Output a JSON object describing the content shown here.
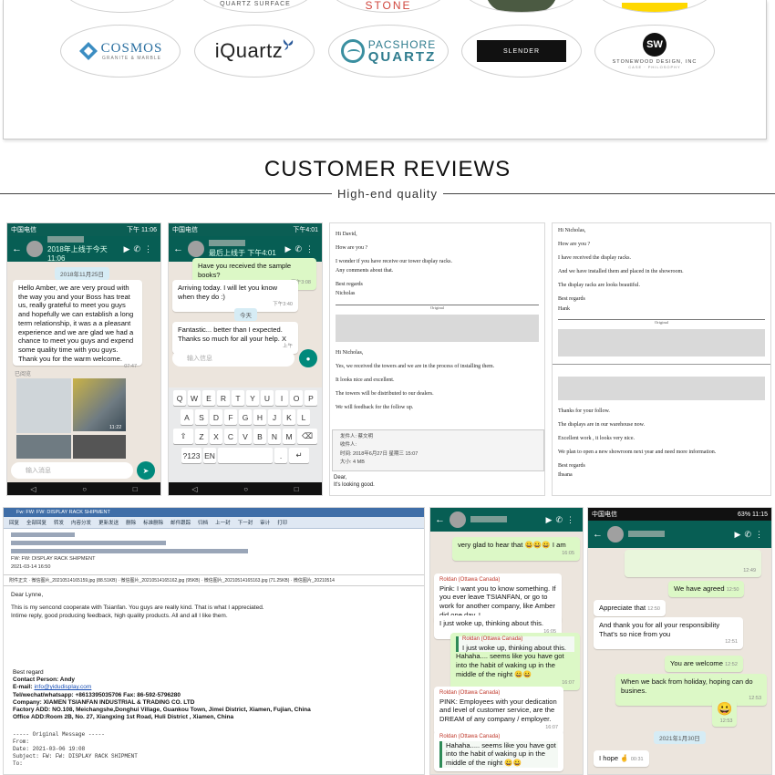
{
  "brands": {
    "top_partial": [
      "QUARTZ SURFACE",
      "STONE"
    ],
    "row": [
      {
        "name": "COSMOS",
        "tagline": "GRANITE & MARBLE"
      },
      {
        "name": "iQuartz"
      },
      {
        "name_top": "PACSHORE",
        "name_bottom": "QUARTZ"
      },
      {
        "name": "SLENDER"
      },
      {
        "name": "STONEWOOD DESIGN, INC",
        "initials": "SW",
        "tagline": "CASE · PHILOSOPHY"
      }
    ]
  },
  "section": {
    "title": "CUSTOMER REVIEWS",
    "subtitle": "High-end quality"
  },
  "shot1": {
    "status": "中国电信",
    "time": "下午 11:06",
    "header_time": "2018年上线于今天 11:06",
    "date_chip": "2018年11月25日",
    "message": "Hello Amber, we are very proud with the way you and your Boss has treat us, really grateful to meet you guys and hopefully we can establish a long term relationship, it was a a pleasant experience and we are glad we had a chance to meet you guys and expend some quality time with you guys. Thank you for the warm welcome.",
    "msg_time": "07:47",
    "read_label": "已阅览",
    "img_time_1": "11:22",
    "img_time_2": "11:22",
    "input_placeholder": "输入消息"
  },
  "shot2": {
    "status": "中国电信",
    "time": "下午4:01",
    "header_time": "最后上线于 下午4:01",
    "out_msg": "Have you received the sample books?",
    "out_time": "下午3:08",
    "in_msg1": "Arriving today. I will let you know when they do :)",
    "in_time1": "下午3:40",
    "today_chip": "今天",
    "in_msg2": "Fantastic... better than I expected. Thanks so much for all your help. X",
    "in_time2": "上午",
    "input_placeholder": "输入信息",
    "keys_row1": [
      "Q",
      "W",
      "E",
      "R",
      "T",
      "Y",
      "U",
      "I",
      "O",
      "P"
    ],
    "keys_row2": [
      "A",
      "S",
      "D",
      "F",
      "G",
      "H",
      "J",
      "K",
      "L"
    ],
    "keys_row3": [
      "Z",
      "X",
      "C",
      "V",
      "B",
      "N",
      "M"
    ],
    "key_num": "?123",
    "key_lang": "EN"
  },
  "shot3": {
    "greeting": "Hi David,",
    "l1": "How are you ?",
    "l2": "I wonder if you have receive our tower display racks.",
    "l3": "Any comments about that.",
    "l4": "Best regards",
    "l5": "Nicholas",
    "orig": "Original",
    "reply_greet": "Hi Nicholas,",
    "r1": "Yes, we received the towers and we are in the process of installing them.",
    "r2": "It looks nice and excellent.",
    "r3": "The towers will be distributed to our dealers.",
    "r4": "We will feedback for the follow up.",
    "from_label": "发件人: 蔡文明",
    "to_label": "收件人:",
    "time_label": "时间: 2018年6月27日 星期三 15:07",
    "size_label": "大小: 4 MB",
    "dear": "Dear,",
    "looking": "It's looking good."
  },
  "shot4": {
    "greeting": "Hi Nicholas,",
    "l1": "How are you ?",
    "l2": "I have received the display racks.",
    "l3": "And we have installed them and placed in the showroom.",
    "l4": "The display racks are looks beautiful.",
    "l5": "Best regards",
    "l6": "Hank",
    "orig": "Original",
    "p1": "Thanks for your follow.",
    "p2": "The displays are in our warehouse now.",
    "p3": "Excellent work , it looks very nice.",
    "p4": "We plan to open a new showroom next year and need more information.",
    "p5": "Best regards",
    "p6": "Ihsana"
  },
  "shot5": {
    "title": "Fw: FW: FW: DISPLAY RACK SHIPMENT",
    "tools": [
      "回复",
      "全部回复",
      "转发",
      "内容分发",
      "更新发送",
      "删除",
      "标准删除",
      "邮件跟踪",
      "归档",
      "上一封",
      "下一封",
      "审计",
      "打印"
    ],
    "subject_line": "FW: FW: DISPLAY RACK SHIPMENT",
    "date_line": "2021-03-14 16:50",
    "attachments": "附件正文 · 微信图片_20210514165159.jpg (88.51KB) · 微信图片_20210514165162.jpg (95KB) · 微信图片_20210514165163.jpg (71.25KB) · 微信图片_20210514",
    "body1": "Dear Lynne,",
    "body2": "This is my sencond cooperate with Tsianfan. You guys are really kind. That is what I appreciated.",
    "body3": "Intime reply, good producing feedback, high quality products. All and all I like them.",
    "sig_regard": "Best regard",
    "sig_contact": "Contact Person: Andy",
    "sig_email_label": "E-mail: ",
    "sig_email": "info@yidudisplay.com",
    "sig_tel": "Tel/wechat/whatsapp: +8613395035706 Fax: 86-592-5796280",
    "sig_company": "Company: XIAMEN TSIANFAN INDUSTRIAL & TRADING CO. LTD",
    "sig_factory": "Factory ADD: NO.108, Meichangshe,Donghui Village, Guankou Town, Jimei District, Xiamen, Fujian, China",
    "sig_office": "Office ADD:Room 2B, No. 27, Xiangxing 1st Road, Huli District , Xiamen, China",
    "orig_header": "----- Original Message -----",
    "orig_from": "From:",
    "orig_date": "Date: 2021-03-06 19:08",
    "orig_subject": "Subject: FW: FW: DISPLAY RACK SHIPMENT",
    "orig_to": "To:"
  },
  "shot6": {
    "m1": "very glad to hear that 😀😀😀 I am",
    "m1_time": "16:05",
    "sender": "Roldan (Ottawa Canada)",
    "m2": "Pink: I want you to know something. If you ever leave TSIANFAN, or go to work for another company, like Amber did one day, I...",
    "m3": "I just woke up, thinking about this.",
    "m3_time": "16:05",
    "m4_quote": "I just woke up, thinking about this.",
    "m4": "Hahaha.... seems like you have got into the habit of waking up in the middle of the night 😀😀",
    "m4_time": "16:07",
    "m5": "PINK: Employees with your dedication and level of customer service, are the DREAM of any company / employer.",
    "m5_time": "16:07",
    "m6_quote": "Hahaha..... seems like you have got into the habit of waking up in the middle of the night 😀😀"
  },
  "shot7": {
    "status": "中国电信",
    "time": "11:15",
    "battery": "63%",
    "card_time": "12:49",
    "o1": "We have agreed",
    "o1_time": "12:50",
    "i1": "Appreciate that",
    "i1_time": "12:50",
    "i2": "And thank you for all your responsibility That's so nice from you",
    "i2_time": "12:51",
    "o2": "You are welcome",
    "o2_time": "12:52",
    "i3": "When we back from holiday, hoping can do busines.",
    "i3_time": "12:53",
    "o3": "😀",
    "o3_time": "12:53",
    "date_chip": "2021年1月30日",
    "i4": "I hope 🤞",
    "i4_time": "00:31"
  }
}
